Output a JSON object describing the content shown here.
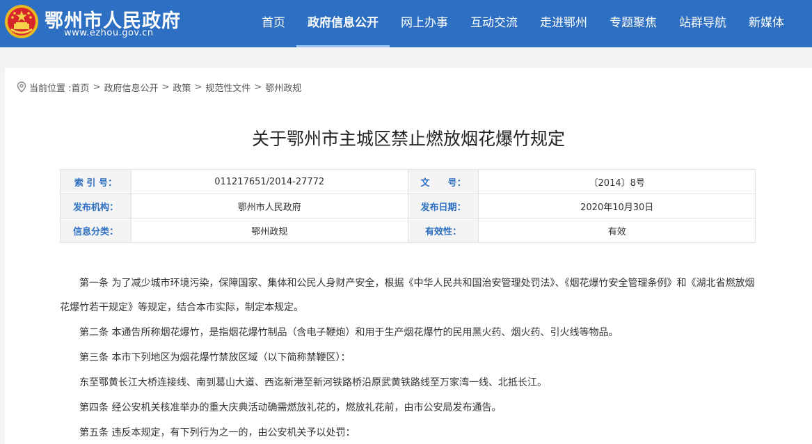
{
  "header": {
    "site_name": "鄂州市人民政府",
    "site_url": "www.ezhou.gov.cn",
    "nav": [
      "首页",
      "政府信息公开",
      "网上办事",
      "互动交流",
      "走进鄂州",
      "专题聚焦",
      "站群导航",
      "新媒体"
    ],
    "active_nav": "政府信息公开"
  },
  "breadcrumb": {
    "prefix": "当前位置 :",
    "items": [
      "首页",
      "政府信息公开",
      "政策",
      "规范性文件",
      "鄂州政规"
    ],
    "separator": ">"
  },
  "document": {
    "title": "关于鄂州市主城区禁止燃放烟花爆竹规定",
    "meta": {
      "index_label": "索 引 号：",
      "index_value": "011217651/2014-27772",
      "doc_no_label": "文　　号：",
      "doc_no_value": "〔2014〕8号",
      "publisher_label": "发布机构：",
      "publisher_value": "鄂州市人民政府",
      "date_label": "发布日期：",
      "date_value": "2020年10月30日",
      "category_label": "信息分类：",
      "category_value": "鄂州政规",
      "validity_label": "有效性：",
      "validity_value": "有效"
    },
    "paragraphs": [
      "第一条 为了减少城市环境污染，保障国家、集体和公民人身财产安全，根据《中华人民共和国治安管理处罚法》、《烟花爆竹安全管理条例》和《湖北省燃放烟花爆竹若干规定》等规定，结合本市实际，制定本规定。",
      "第二条 本通告所称烟花爆竹，是指烟花爆竹制品（含电子鞭炮）和用于生产烟花爆竹的民用黑火药、烟火药、引火线等物品。",
      "第三条 本市下列地区为烟花爆竹禁放区域（以下简称禁鞭区）：",
      "东至鄂黄长江大桥连接线、南到葛山大道、西迄新港至新河铁路桥沿原武黄铁路线至万家湾一线、北抵长江。",
      "第四条 经公安机关核准举办的重大庆典活动确需燃放礼花的，燃放礼花前，由市公安局发布通告。",
      "第五条 违反本规定，有下列行为之一的，由公安机关予以处罚："
    ]
  },
  "colors": {
    "header_blue": "#2d6fc2",
    "label_blue": "#2d6fc2",
    "page_bg": "#f3f3f3"
  }
}
